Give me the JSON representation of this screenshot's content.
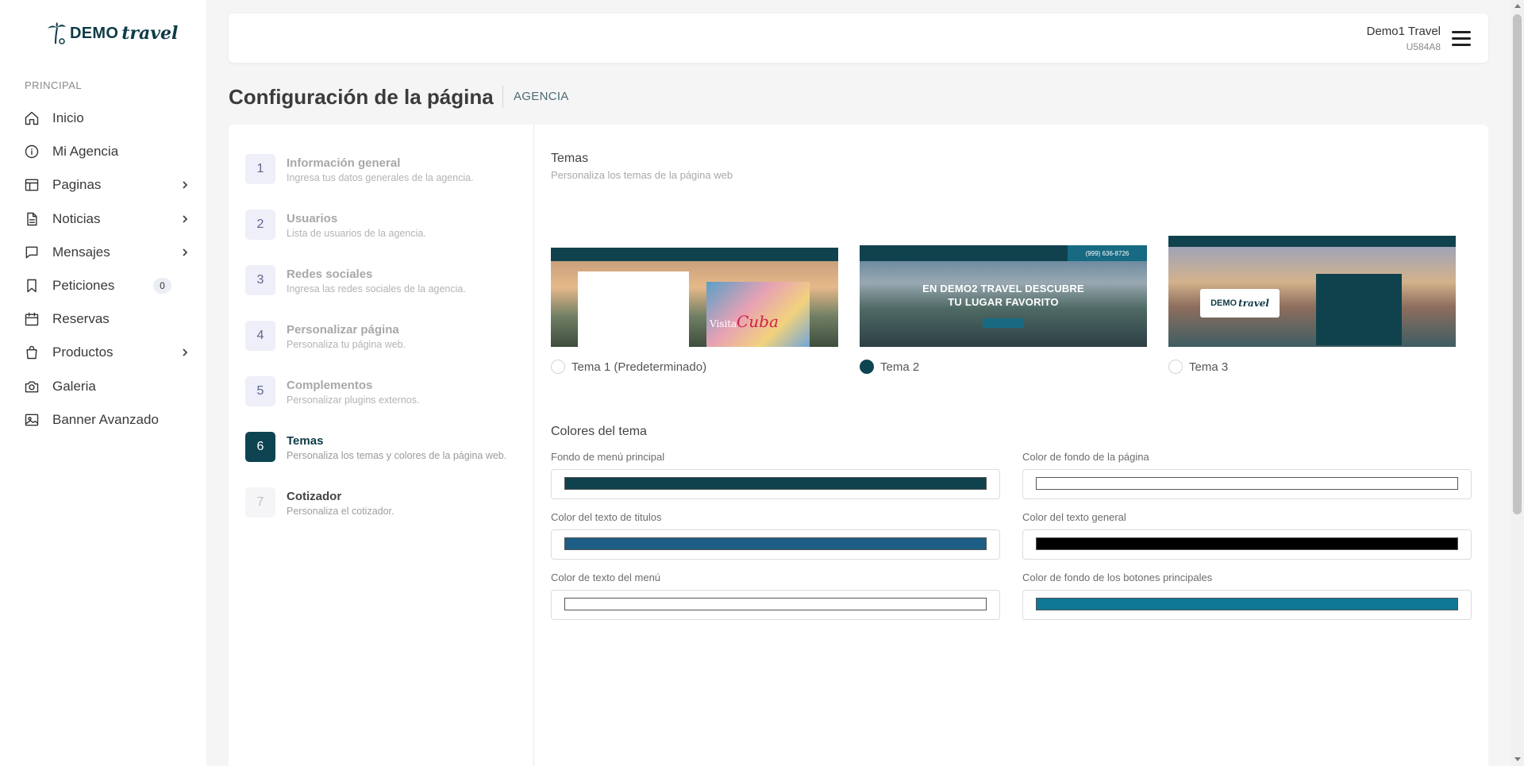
{
  "brand": {
    "logo_demo": "DEMO",
    "logo_travel": "travel",
    "primary_color": "#0e4451"
  },
  "sidebar": {
    "section_label": "PRINCIPAL",
    "items": [
      {
        "label": "Inicio",
        "icon": "home-icon"
      },
      {
        "label": "Mi Agencia",
        "icon": "info-icon"
      },
      {
        "label": "Paginas",
        "icon": "layout-icon",
        "has_submenu": true
      },
      {
        "label": "Noticias",
        "icon": "document-icon",
        "has_submenu": true
      },
      {
        "label": "Mensajes",
        "icon": "message-icon",
        "has_submenu": true
      },
      {
        "label": "Peticiones",
        "icon": "bookmark-icon",
        "badge": "0"
      },
      {
        "label": "Reservas",
        "icon": "calendar-icon"
      },
      {
        "label": "Productos",
        "icon": "shopping-bag-icon",
        "has_submenu": true
      },
      {
        "label": "Galeria",
        "icon": "camera-icon"
      },
      {
        "label": "Banner Avanzado",
        "icon": "image-icon"
      }
    ]
  },
  "header": {
    "user_name": "Demo1 Travel",
    "user_id": "U584A8"
  },
  "page": {
    "title": "Configuración de la página",
    "tag": "AGENCIA"
  },
  "steps": [
    {
      "num": "1",
      "title": "Información general",
      "subtitle": "Ingresa tus datos generales de la agencia."
    },
    {
      "num": "2",
      "title": "Usuarios",
      "subtitle": "Lista de usuarios de la agencia."
    },
    {
      "num": "3",
      "title": "Redes sociales",
      "subtitle": "Ingresa las redes sociales de la agencia."
    },
    {
      "num": "4",
      "title": "Personalizar página",
      "subtitle": "Personaliza tu página web."
    },
    {
      "num": "5",
      "title": "Complementos",
      "subtitle": "Personalizar plugins externos."
    },
    {
      "num": "6",
      "title": "Temas",
      "subtitle": "Personaliza los temas y colores de la página web."
    },
    {
      "num": "7",
      "title": "Cotizador",
      "subtitle": "Personaliza el cotizador."
    }
  ],
  "themes": {
    "title": "Temas",
    "subtitle": "Personaliza los temas de la página web",
    "options": [
      {
        "label": "Tema 1 (Predeterminado)",
        "selected": false,
        "preview_text": "Visita",
        "preview_accent": "Cuba"
      },
      {
        "label": "Tema 2",
        "selected": true,
        "preview_headline_1": "EN DEMO2 TRAVEL DESCUBRE",
        "preview_headline_2": "TU LUGAR FAVORITO",
        "preview_phone": "(999) 636-8726"
      },
      {
        "label": "Tema 3",
        "selected": false,
        "preview_logo_demo": "DEMO",
        "preview_logo_travel": "travel"
      }
    ]
  },
  "theme_colors": {
    "title": "Colores del tema",
    "fields": [
      {
        "label": "Fondo de menú principal",
        "color": "#10424e"
      },
      {
        "label": "Color de fondo de la página",
        "color": "#ffffff"
      },
      {
        "label": "Color del texto de titulos",
        "color": "#1e5e86"
      },
      {
        "label": "Color del texto general",
        "color": "#000000"
      },
      {
        "label": "Color de texto del menú",
        "color": "#ffffff"
      },
      {
        "label": "Color de fondo de los botones principales",
        "color": "#0f7896"
      }
    ]
  }
}
